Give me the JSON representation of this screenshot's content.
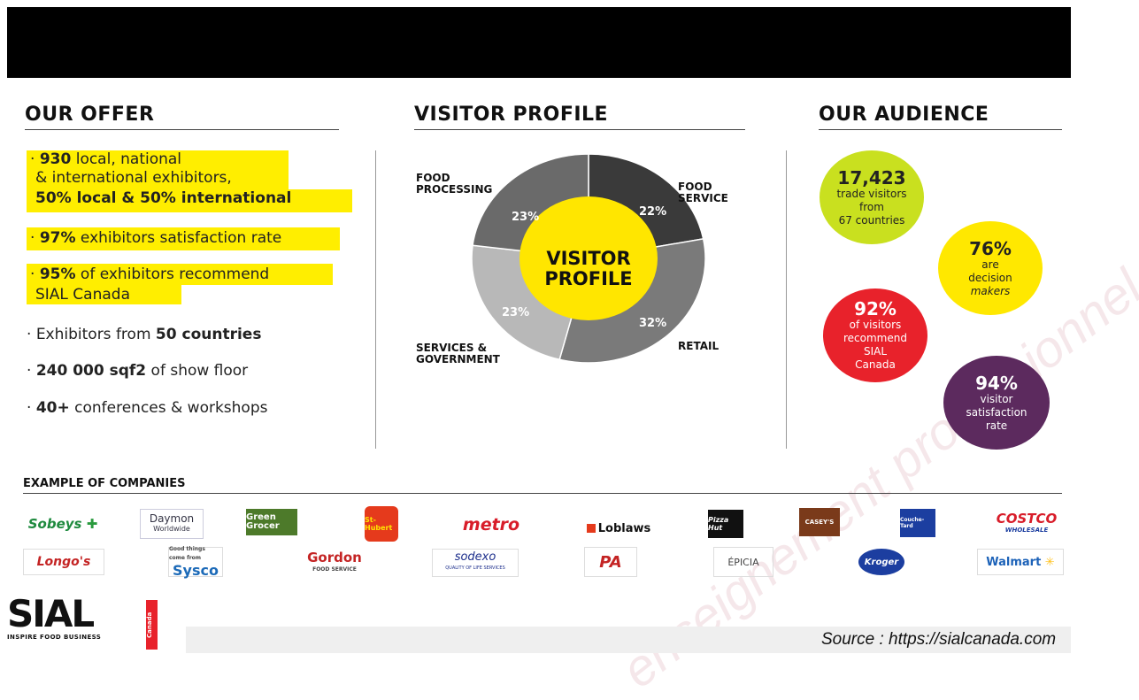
{
  "offer": {
    "title": "OUR OFFER",
    "b1_num": "930",
    "b1_rest": " local, national",
    "b1_line2": "& international exhibitors,",
    "b1_line3": "50% local & 50% international",
    "b2_num": "97%",
    "b2_rest": " exhibitors satisfaction rate",
    "b3_num": "95%",
    "b3_rest": " of exhibitors recommend",
    "b3_line2": "SIAL Canada",
    "b4_pre": "Exhibitors from ",
    "b4_bold": "50 countries",
    "b5_bold": "240 000 sqf2",
    "b5_rest": " of show floor",
    "b6_bold": "40+",
    "b6_rest": " conferences & workshops",
    "bullet_mark": "·"
  },
  "visitor": {
    "title": "VISITOR PROFILE",
    "center_line1": "VISITOR",
    "center_line2": "PROFILE",
    "segments": [
      {
        "label_l1": "FOOD",
        "label_l2": "SERVICE",
        "pct": "22%",
        "value": 22,
        "color": "#3a3a3a"
      },
      {
        "label_l1": "RETAIL",
        "label_l2": "",
        "pct": "32%",
        "value": 32,
        "color": "#7a7a7a"
      },
      {
        "label_l1": "SERVICES &",
        "label_l2": "GOVERNMENT",
        "pct": "23%",
        "value": 23,
        "color": "#b8b8b8"
      },
      {
        "label_l1": "FOOD",
        "label_l2": "PROCESSING",
        "pct": "23%",
        "value": 23,
        "color": "#6a6a6a"
      }
    ],
    "center_color": "#ffe600"
  },
  "audience": {
    "title": "OUR AUDIENCE",
    "c1_big": "17,423",
    "c1_l1": "trade visitors",
    "c1_l2": "from",
    "c1_l3": "67 countries",
    "c2_big": "76%",
    "c2_l1": "are",
    "c2_l2": "decision",
    "c2_l3": "makers",
    "c3_big": "92%",
    "c3_l1": "of visitors",
    "c3_l2": "recommend",
    "c3_l3": "SIAL",
    "c3_l4": "Canada",
    "c4_big": "94%",
    "c4_l1": "visitor",
    "c4_l2": "satisfaction",
    "c4_l3": "rate",
    "colors": {
      "green": "#c9e01f",
      "yellow": "#ffe800",
      "red": "#e8222b",
      "purple": "#5c2a5e"
    }
  },
  "companies": {
    "title": "EXAMPLE OF COMPANIES",
    "row1": [
      "Sobeys",
      "Daymon",
      "Green Grocer",
      "St-Hubert",
      "metro",
      "Loblaws",
      "Pizza Hut",
      "CASEY'S",
      "Couche-Tard",
      "COSTCO"
    ],
    "row2": [
      "Longo's",
      "Sysco",
      "Gordon",
      "sodexo",
      "PA",
      "ÉPICIA",
      "Kroger",
      "Walmart"
    ],
    "sub_daymon": "Worldwide",
    "sub_gordon": "FOOD SERVICE",
    "sub_sodexo": "QUALITY OF LIFE SERVICES",
    "sub_costco": "WHOLESALE",
    "sub_sysco": "Good things come from"
  },
  "footer": {
    "logo": "SIAL",
    "logo_tag": "INSPIRE FOOD BUSINESS",
    "logo_side": "Canada",
    "source": "Source : https://sialcanada.com"
  },
  "watermark": "enseignement professionnel"
}
